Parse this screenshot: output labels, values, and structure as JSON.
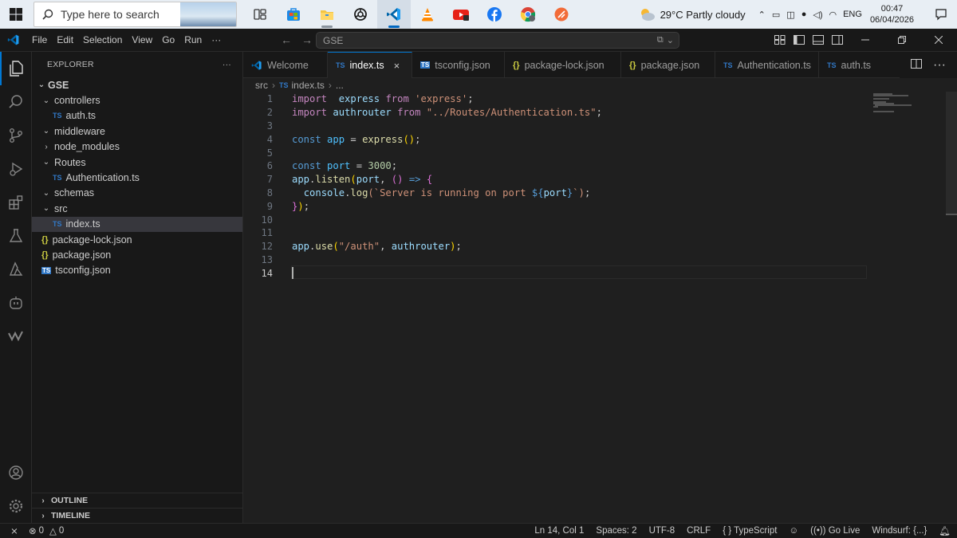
{
  "taskbar": {
    "search_placeholder": "Type here to search",
    "weather": {
      "temp": "29°C",
      "condition": "Partly cloudy"
    },
    "language": "ENG",
    "time": "00:47",
    "date": "06/04/2026",
    "apps": [
      "task-view-icon",
      "microsoft-store-icon",
      "file-explorer-icon",
      "chatgpt-icon",
      "vscode-icon",
      "vlc-icon",
      "youtube-icon",
      "facebook-icon",
      "chrome-icon",
      "app-icon"
    ]
  },
  "titlebar": {
    "menu": [
      "File",
      "Edit",
      "Selection",
      "View",
      "Go",
      "Run",
      "···"
    ],
    "command_center": "GSE"
  },
  "sidebar": {
    "title": "EXPLORER",
    "project": "GSE",
    "tree": [
      {
        "label": "controllers",
        "type": "folder",
        "open": true,
        "depth": 1
      },
      {
        "label": "auth.ts",
        "type": "ts",
        "depth": 2
      },
      {
        "label": "middleware",
        "type": "folder",
        "open": true,
        "depth": 1
      },
      {
        "label": "node_modules",
        "type": "folder",
        "open": false,
        "depth": 1
      },
      {
        "label": "Routes",
        "type": "folder",
        "open": true,
        "depth": 1
      },
      {
        "label": "Authentication.ts",
        "type": "ts",
        "depth": 2
      },
      {
        "label": "schemas",
        "type": "folder",
        "open": true,
        "depth": 1
      },
      {
        "label": "src",
        "type": "folder",
        "open": true,
        "depth": 1
      },
      {
        "label": "index.ts",
        "type": "ts",
        "depth": 2,
        "selected": true
      },
      {
        "label": "package-lock.json",
        "type": "json",
        "depth": 1
      },
      {
        "label": "package.json",
        "type": "json",
        "depth": 1
      },
      {
        "label": "tsconfig.json",
        "type": "tsconfig",
        "depth": 1
      }
    ],
    "outline": "OUTLINE",
    "timeline": "TIMELINE"
  },
  "tabs": [
    {
      "label": "Welcome",
      "icon": "vscode",
      "active": false
    },
    {
      "label": "index.ts",
      "icon": "TS",
      "active": true
    },
    {
      "label": "tsconfig.json",
      "icon": "tsconfig",
      "active": false
    },
    {
      "label": "package-lock.json",
      "icon": "{}",
      "active": false
    },
    {
      "label": "package.json",
      "icon": "{}",
      "active": false
    },
    {
      "label": "Authentication.ts",
      "icon": "TS",
      "active": false
    },
    {
      "label": "auth.ts",
      "icon": "TS",
      "active": false
    }
  ],
  "breadcrumb": {
    "folder": "src",
    "file": "index.ts",
    "more": "..."
  },
  "editor": {
    "current_line": 14,
    "lines": [
      [
        [
          "kw",
          "import"
        ],
        [
          "",
          "  "
        ],
        [
          "var",
          "express"
        ],
        [
          "",
          " "
        ],
        [
          "kw",
          "from"
        ],
        [
          "",
          " "
        ],
        [
          "str",
          "'express'"
        ],
        [
          "",
          ";"
        ]
      ],
      [
        [
          "kw",
          "import"
        ],
        [
          "",
          " "
        ],
        [
          "var",
          "authrouter"
        ],
        [
          "",
          " "
        ],
        [
          "kw",
          "from"
        ],
        [
          "",
          " "
        ],
        [
          "str",
          "\"../Routes/Authentication.ts\""
        ],
        [
          "",
          ";"
        ]
      ],
      [],
      [
        [
          "kw2",
          "const"
        ],
        [
          "",
          " "
        ],
        [
          "const",
          "app"
        ],
        [
          "",
          " = "
        ],
        [
          "fn",
          "express"
        ],
        [
          "brace",
          "()"
        ],
        [
          "",
          ";"
        ]
      ],
      [],
      [
        [
          "kw2",
          "const"
        ],
        [
          "",
          " "
        ],
        [
          "const",
          "port"
        ],
        [
          "",
          " = "
        ],
        [
          "num",
          "3000"
        ],
        [
          "",
          ";"
        ]
      ],
      [
        [
          "var",
          "app"
        ],
        [
          "",
          "."
        ],
        [
          "fn",
          "listen"
        ],
        [
          "brace",
          "("
        ],
        [
          "var",
          "port"
        ],
        [
          "",
          ", "
        ],
        [
          "brace2",
          "()"
        ],
        [
          "",
          " "
        ],
        [
          "kw2",
          "=>"
        ],
        [
          "",
          " "
        ],
        [
          "brace2",
          "{"
        ]
      ],
      [
        [
          "",
          "  "
        ],
        [
          "var",
          "console"
        ],
        [
          "",
          "."
        ],
        [
          "fn",
          "log"
        ],
        [
          "str",
          "(`Server is running on port "
        ],
        [
          "kw2",
          "${"
        ],
        [
          "var",
          "port"
        ],
        [
          "kw2",
          "}"
        ],
        [
          "str",
          "`)"
        ],
        [
          "",
          ";"
        ]
      ],
      [
        [
          "brace2",
          "}"
        ],
        [
          "brace",
          ")"
        ],
        [
          "",
          ";"
        ]
      ],
      [],
      [],
      [
        [
          "var",
          "app"
        ],
        [
          "",
          "."
        ],
        [
          "fn",
          "use"
        ],
        [
          "brace",
          "("
        ],
        [
          "str",
          "\"/auth\""
        ],
        [
          "",
          ", "
        ],
        [
          "var",
          "authrouter"
        ],
        [
          "brace",
          ")"
        ],
        [
          "",
          ";"
        ]
      ],
      [],
      []
    ]
  },
  "statusbar": {
    "errors": "0",
    "warnings": "0",
    "position": "Ln 14, Col 1",
    "spaces": "Spaces: 2",
    "encoding": "UTF-8",
    "eol": "CRLF",
    "language": "TypeScript",
    "golive": "Go Live",
    "windsurf": "Windsurf: {...}"
  }
}
